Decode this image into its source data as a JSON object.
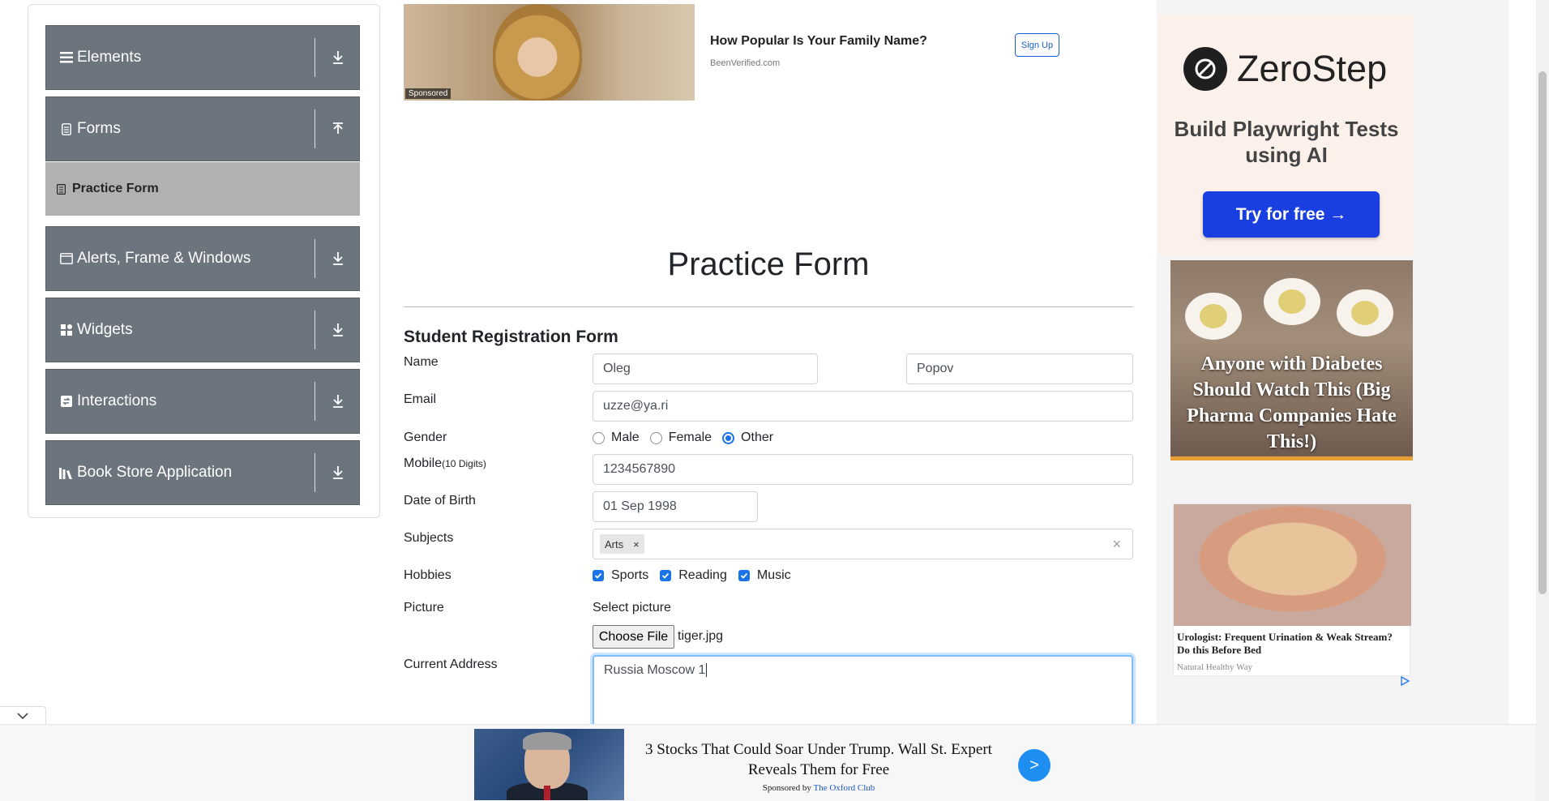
{
  "sidebar": {
    "groups": [
      {
        "label": "Elements"
      },
      {
        "label": "Forms"
      },
      {
        "label": "Alerts, Frame & Windows"
      },
      {
        "label": "Widgets"
      },
      {
        "label": "Interactions"
      },
      {
        "label": "Book Store Application"
      }
    ],
    "active_item": "Practice Form"
  },
  "top_ad": {
    "sponsored": "Sponsored",
    "title": "How Popular Is Your Family Name?",
    "source": "BeenVerified.com",
    "button": "Sign Up"
  },
  "form": {
    "page_title": "Practice Form",
    "heading": "Student Registration Form",
    "name_label": "Name",
    "first_name": "Oleg",
    "last_name": "Popov",
    "email_label": "Email",
    "email": "uzze@ya.ri",
    "gender_label": "Gender",
    "gender_options": [
      "Male",
      "Female",
      "Other"
    ],
    "gender_selected": "Other",
    "mobile_label": "Mobile",
    "mobile_hint": "(10 Digits)",
    "mobile": "1234567890",
    "dob_label": "Date of Birth",
    "dob": "01 Sep 1998",
    "subjects_label": "Subjects",
    "subjects": [
      "Arts"
    ],
    "subject_remove": "×",
    "subjects_clear": "×",
    "hobbies_label": "Hobbies",
    "hobbies": [
      "Sports",
      "Reading",
      "Music"
    ],
    "hobbies_checked": [
      true,
      true,
      true
    ],
    "picture_label": "Picture",
    "picture_prompt": "Select picture",
    "choose_file": "Choose File",
    "file_name": "tiger.jpg",
    "address_label": "Current Address",
    "address": "Russia Moscow 1"
  },
  "right_ads": {
    "zerostep_name": "ZeroStep",
    "zerostep_tagline": "Build Playwright Tests using AI",
    "zerostep_button": "Try for free →",
    "diabetes_text": "Anyone with Diabetes Should Watch This (Big Pharma Companies Hate This!)",
    "uro_title": "Urologist: Frequent Urination & Weak Stream? Do this Before Bed",
    "uro_source": "Natural Healthy Way"
  },
  "bottom_ad": {
    "title": "3 Stocks That Could Soar Under Trump. Wall St. Expert Reveals Them for Free",
    "sponsored_prefix": "Sponsored by",
    "sponsor": "The Oxford Club",
    "go": ">"
  },
  "colors": {
    "sidebar_group": "#6c757d",
    "sidebar_active": "#b1b1b1",
    "accent": "#1a73e8",
    "zerostep_button": "#1a3fe0"
  }
}
